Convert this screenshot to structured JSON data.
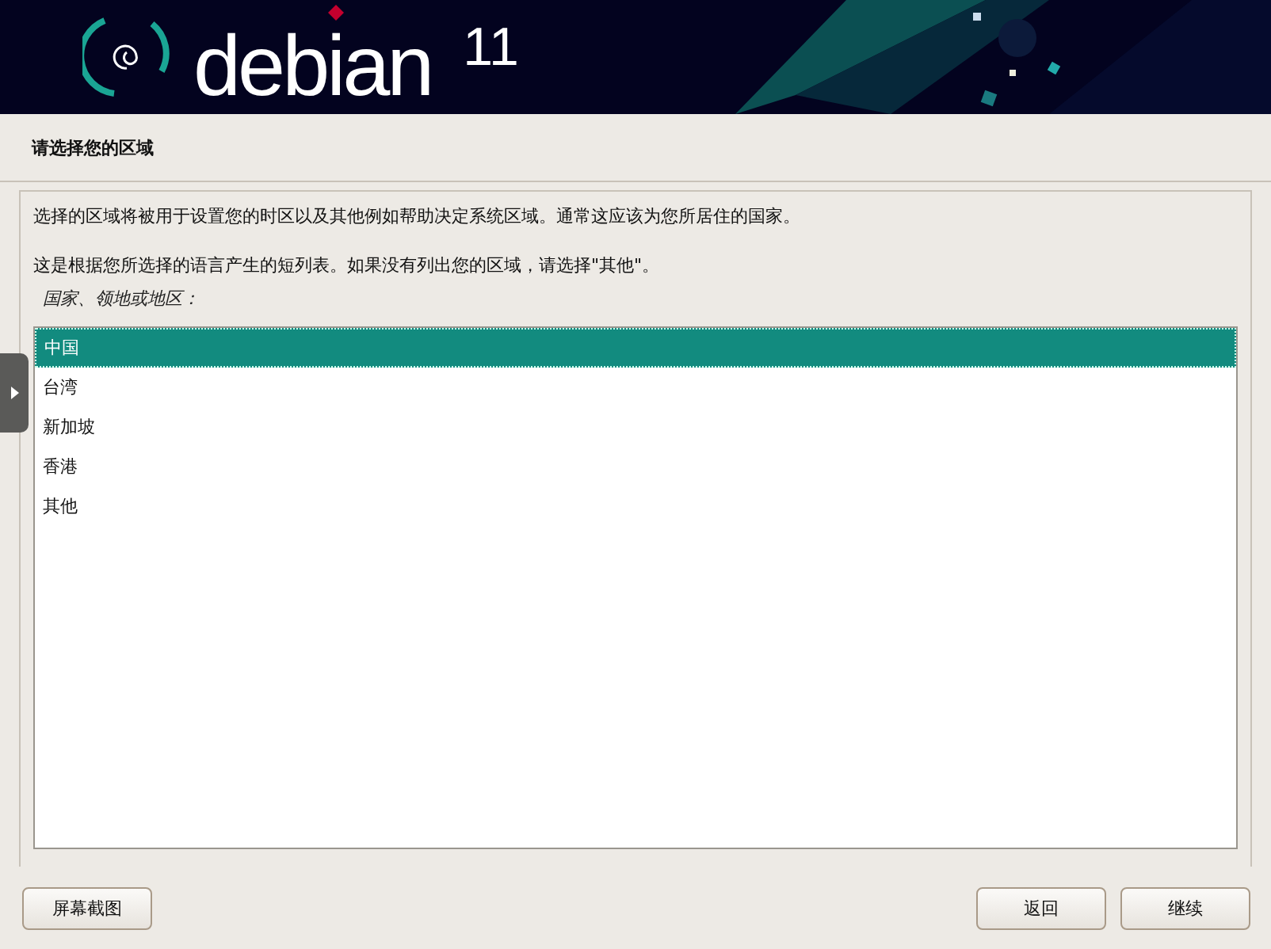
{
  "banner": {
    "logo_text": "debian",
    "version": "11"
  },
  "page_title": "请选择您的区域",
  "paragraphs": [
    "选择的区域将被用于设置您的时区以及其他例如帮助决定系统区域。通常这应该为您所居住的国家。",
    "这是根据您所选择的语言产生的短列表。如果没有列出您的区域，请选择\"其他\"。"
  ],
  "list_label": "国家、领地或地区：",
  "items": [
    {
      "label": "中国",
      "selected": true
    },
    {
      "label": "台湾",
      "selected": false
    },
    {
      "label": "新加坡",
      "selected": false
    },
    {
      "label": "香港",
      "selected": false
    },
    {
      "label": "其他",
      "selected": false
    }
  ],
  "buttons": {
    "left": [
      "屏幕截图"
    ],
    "right": [
      "返回",
      "继续"
    ]
  }
}
